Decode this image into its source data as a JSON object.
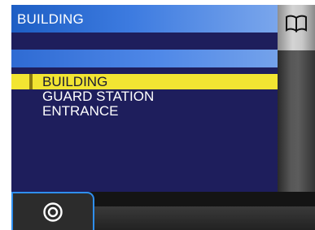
{
  "header": {
    "title": "BUILDING",
    "icon": "book-icon"
  },
  "list": {
    "items": [
      {
        "label": "BUILDING",
        "selected": true
      },
      {
        "label": "GUARD STATION",
        "selected": false
      },
      {
        "label": "ENTRANCE",
        "selected": false
      }
    ]
  },
  "softkeys": [
    {
      "icon": "target-icon",
      "active": true
    },
    {
      "icon": "",
      "active": false
    },
    {
      "icon": "",
      "active": false
    },
    {
      "icon": "",
      "active": false
    }
  ],
  "colors": {
    "title_bar": "#2f6bd3",
    "list_background": "#1e1e5c",
    "selection": "#f2e532",
    "active_key_outline": "#2f8ff0"
  }
}
